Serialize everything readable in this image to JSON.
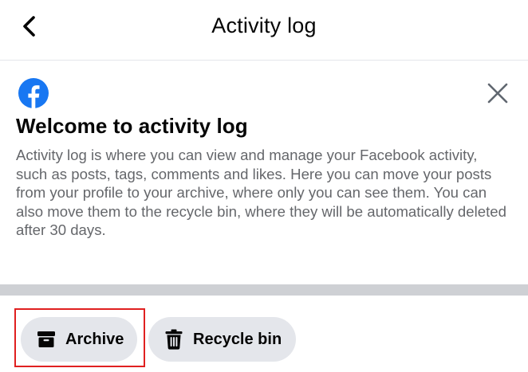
{
  "header": {
    "title": "Activity log",
    "back_icon": "chevron-left-icon"
  },
  "welcome_card": {
    "logo_icon": "facebook-logo-icon",
    "close_icon": "close-icon",
    "title": "Welcome to activity log",
    "body": "Activity log is where you can view and manage your Facebook activity, such as posts, tags, comments and likes. Here you can move your posts from your profile to your archive, where only you can see them. You can also move them to the recycle bin, where they will be automatically deleted after 30 days."
  },
  "filters": {
    "archive": {
      "label": "Archive",
      "icon": "archive-box-icon"
    },
    "recycle_bin": {
      "label": "Recycle bin",
      "icon": "trash-icon"
    }
  },
  "colors": {
    "brand": "#1877f2",
    "chip_bg": "#e4e6eb",
    "divider": "#ced0d4",
    "secondary_text": "#65676b",
    "highlight": "#e02020"
  }
}
